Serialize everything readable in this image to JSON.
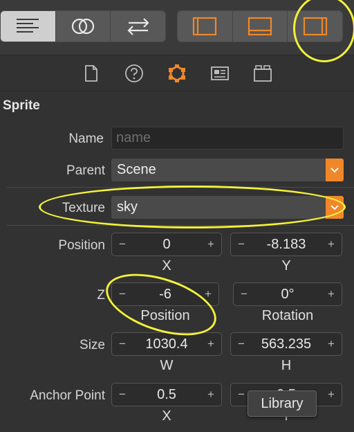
{
  "toolbar": {
    "left_group": [
      {
        "icon": "align-left-icon",
        "active": true
      },
      {
        "icon": "circles-overlap-icon",
        "active": false
      },
      {
        "icon": "swap-arrows-icon",
        "active": false
      }
    ],
    "right_group": [
      {
        "icon": "left-panel-icon"
      },
      {
        "icon": "bottom-panel-icon"
      },
      {
        "icon": "right-panel-icon"
      }
    ]
  },
  "tabs": [
    "document-icon",
    "help-icon",
    "node-inspector-icon",
    "media-icon",
    "library-icon"
  ],
  "section": {
    "title": "Sprite"
  },
  "fields": {
    "name": {
      "label": "Name",
      "placeholder": "name",
      "value": ""
    },
    "parent": {
      "label": "Parent",
      "value": "Scene"
    },
    "texture": {
      "label": "Texture",
      "value": "sky"
    }
  },
  "position": {
    "label": "Position",
    "x": "0",
    "y": "-8.183",
    "x_label": "X",
    "y_label": "Y"
  },
  "z_row": {
    "label": "Z",
    "z": "-6",
    "z_caption": "Position",
    "rotation": "0°",
    "rotation_caption": "Rotation"
  },
  "size": {
    "label": "Size",
    "w": "1030.4",
    "h": "563.235",
    "w_label": "W",
    "h_label": "H"
  },
  "anchor": {
    "label": "Anchor Point",
    "x": "0.5",
    "y": "0.5",
    "x_label": "X",
    "y_label": "Y"
  },
  "stepper": {
    "minus": "−",
    "plus": "+"
  },
  "tooltip": "Library",
  "colors": {
    "accent": "#f0882a",
    "highlight": "#f3f13a",
    "background": "#323232"
  }
}
